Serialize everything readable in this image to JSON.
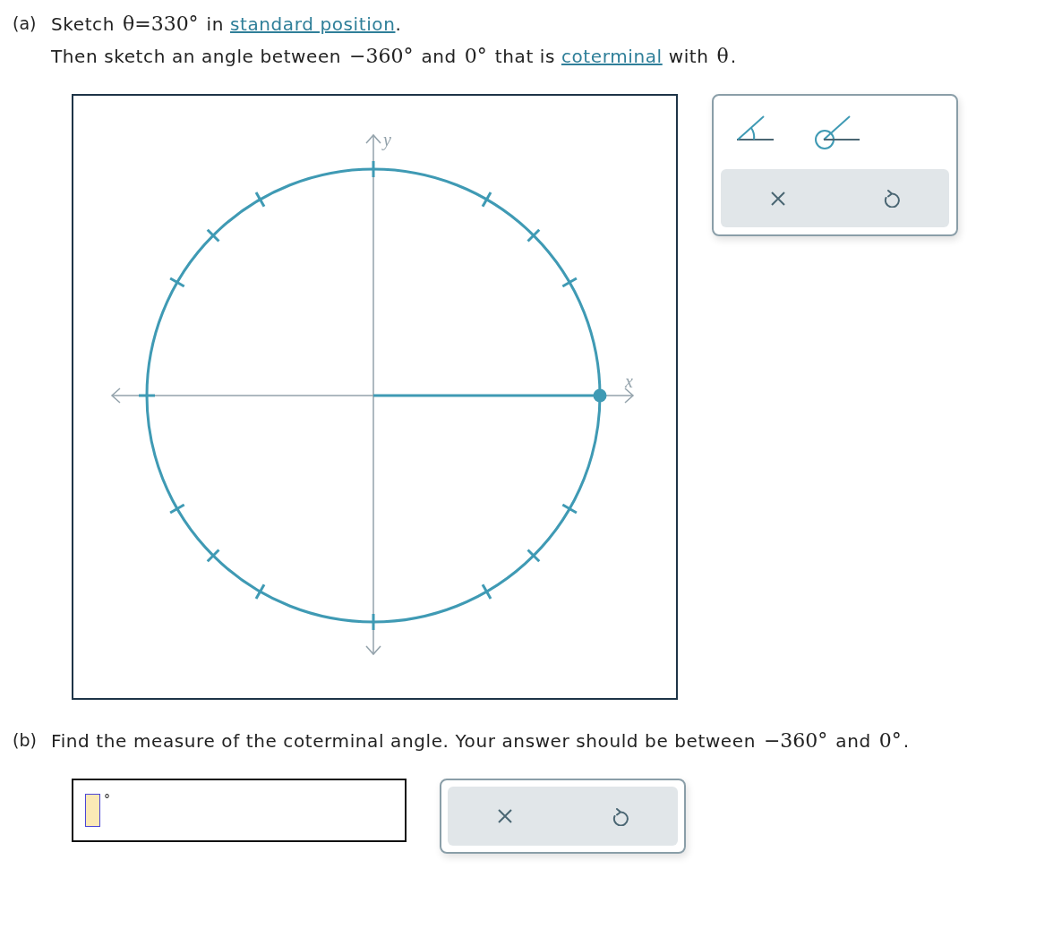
{
  "part_a": {
    "label": "(a)",
    "lines": [
      [
        {
          "kind": "text",
          "text": "Sketch "
        },
        {
          "kind": "math",
          "text": "θ=330°"
        },
        {
          "kind": "text",
          "text": " in "
        },
        {
          "kind": "link",
          "text": "standard position"
        },
        {
          "kind": "text",
          "text": "."
        }
      ],
      [
        {
          "kind": "text",
          "text": "Then sketch an angle between "
        },
        {
          "kind": "math",
          "text": "−360°"
        },
        {
          "kind": "text",
          "text": " and "
        },
        {
          "kind": "math",
          "text": "0°"
        },
        {
          "kind": "text",
          "text": " that is "
        },
        {
          "kind": "link",
          "text": "coterminal"
        },
        {
          "kind": "text",
          "text": " with "
        },
        {
          "kind": "math",
          "text": "θ"
        },
        {
          "kind": "text",
          "text": "."
        }
      ]
    ]
  },
  "graph": {
    "x_label": "x",
    "y_label": "y"
  },
  "graph_tools": {
    "tools": [
      {
        "kind": "angle"
      },
      {
        "kind": "reflex-angle"
      }
    ],
    "actions": [
      {
        "kind": "clear"
      },
      {
        "kind": "undo"
      }
    ]
  },
  "part_b": {
    "label": "(b)",
    "lines": [
      [
        {
          "kind": "text",
          "text": "Find the measure of the coterminal angle. Your answer should be between "
        },
        {
          "kind": "math",
          "text": "−360°"
        },
        {
          "kind": "text",
          "text": " and "
        },
        {
          "kind": "math",
          "text": "0°"
        },
        {
          "kind": "text",
          "text": "."
        }
      ]
    ]
  },
  "answer": {
    "unit": "°"
  },
  "answer_actions": [
    {
      "kind": "clear"
    },
    {
      "kind": "undo"
    }
  ]
}
